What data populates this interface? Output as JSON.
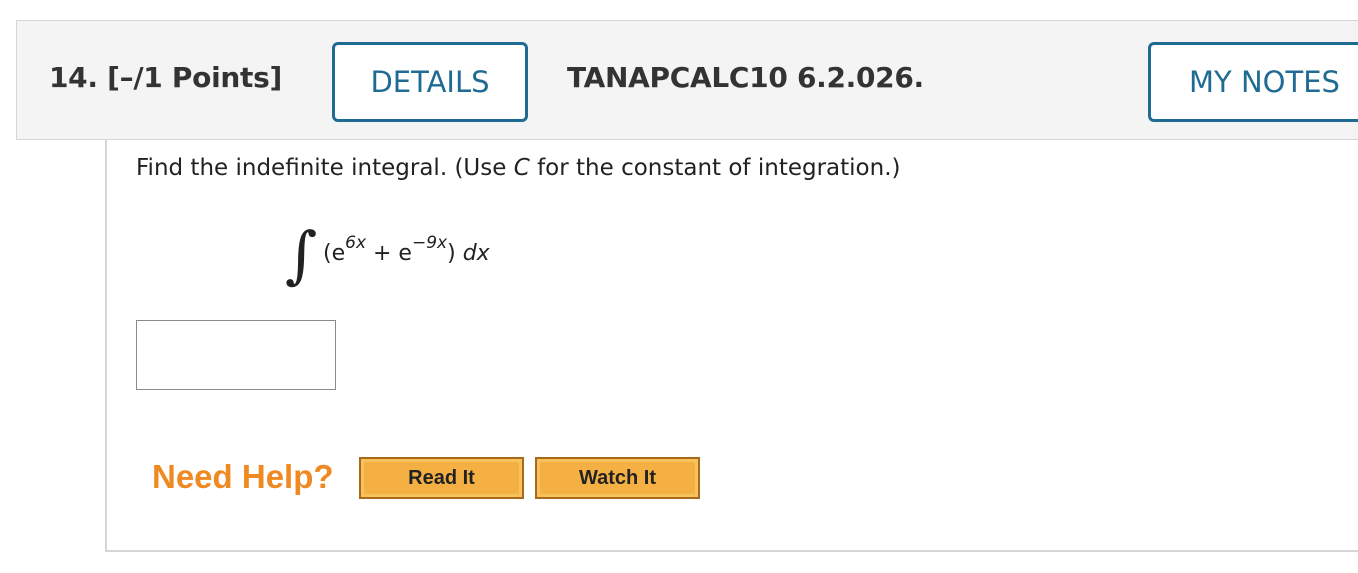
{
  "question": {
    "number_label": "14.",
    "points_label": "[–/1 Points]",
    "details_label": "DETAILS",
    "code": "TANAPCALC10 6.2.026.",
    "my_notes_label": "MY NOTES"
  },
  "prompt": {
    "before": "Find the indefinite integral. (Use ",
    "constant": "C",
    "after": " for the constant of integration.)"
  },
  "formula": {
    "integral_symbol": "∫",
    "open_paren": "(e",
    "exp1": "6x",
    "plus_e": " + e",
    "exp2": "−9x",
    "close_paren": ") ",
    "dx": "dx"
  },
  "answer": {
    "value": "",
    "placeholder": ""
  },
  "help": {
    "need_help_label": "Need Help?",
    "read_it_label": "Read It",
    "watch_it_label": "Watch It"
  },
  "colors": {
    "accent_blue": "#1f6b94",
    "help_orange": "#ef8a23",
    "button_orange": "#f4b042"
  }
}
